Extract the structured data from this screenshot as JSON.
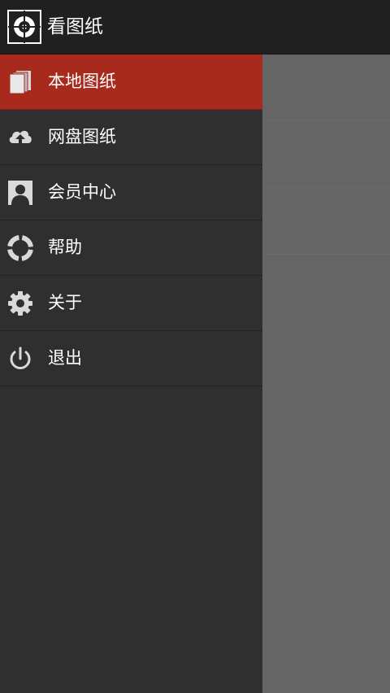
{
  "app": {
    "title": "看图纸",
    "logo_icon": "crosshair-target-icon"
  },
  "drawer": {
    "items": [
      {
        "label": "本地图纸",
        "icon": "documents-icon",
        "active": true
      },
      {
        "label": "网盘图纸",
        "icon": "cloud-upload-icon",
        "active": false
      },
      {
        "label": "会员中心",
        "icon": "user-profile-icon",
        "active": false
      },
      {
        "label": "帮助",
        "icon": "lifebuoy-icon",
        "active": false
      },
      {
        "label": "关于",
        "icon": "gear-icon",
        "active": false
      },
      {
        "label": "退出",
        "icon": "power-icon",
        "active": false
      }
    ]
  },
  "colors": {
    "titlebar": "#202020",
    "drawer_bg": "#2f2f2f",
    "active_item": "#a82a1c",
    "content_bg": "#656565",
    "icon": "#d9d9d9"
  }
}
